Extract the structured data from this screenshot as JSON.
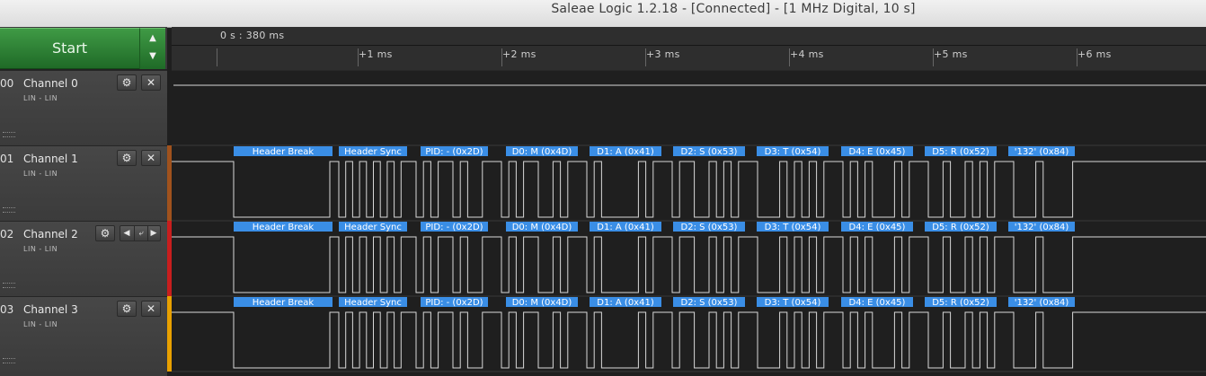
{
  "window": {
    "title": "Saleae Logic 1.2.18 - [Connected] - [1 MHz Digital, 10 s]"
  },
  "toolbar": {
    "start_label": "Start",
    "up_arrow": "▲",
    "down_arrow": "▼"
  },
  "ruler": {
    "timestamp": "0 s : 380 ms",
    "ticks": [
      "+1 ms",
      "+2 ms",
      "+3 ms",
      "+4 ms",
      "+5 ms",
      "+6 ms"
    ]
  },
  "channels": [
    {
      "num": "00",
      "name": "Channel 0",
      "analyzer": "LIN - LIN",
      "color": "",
      "settings_icon": "⚙",
      "close_icon": "✕"
    },
    {
      "num": "01",
      "name": "Channel 1",
      "analyzer": "LIN - LIN",
      "color": "#a0521d",
      "settings_icon": "⚙",
      "close_icon": "✕"
    },
    {
      "num": "02",
      "name": "Channel 2",
      "analyzer": "LIN - LIN",
      "color": "#c81e1e",
      "settings_icon": "⚙",
      "prev_edge": "◀",
      "edge_icon": "⤶",
      "next_edge": "▶"
    },
    {
      "num": "03",
      "name": "Channel 3",
      "analyzer": "LIN - LIN",
      "color": "#e8a000",
      "settings_icon": "⚙",
      "close_icon": "✕"
    }
  ],
  "decode_labels": [
    "Header Break",
    "Header Sync",
    "PID: - (0x2D)",
    "D0: M (0x4D)",
    "D1: A (0x41)",
    "D2: S (0x53)",
    "D3: T (0x54)",
    "D4: E (0x45)",
    "D5: R (0x52)",
    "'132' (0x84)"
  ],
  "colors": {
    "accent_green": "#2f8a36",
    "decode_blue": "#3a8ee6",
    "waveform": "#d8d8d8"
  }
}
